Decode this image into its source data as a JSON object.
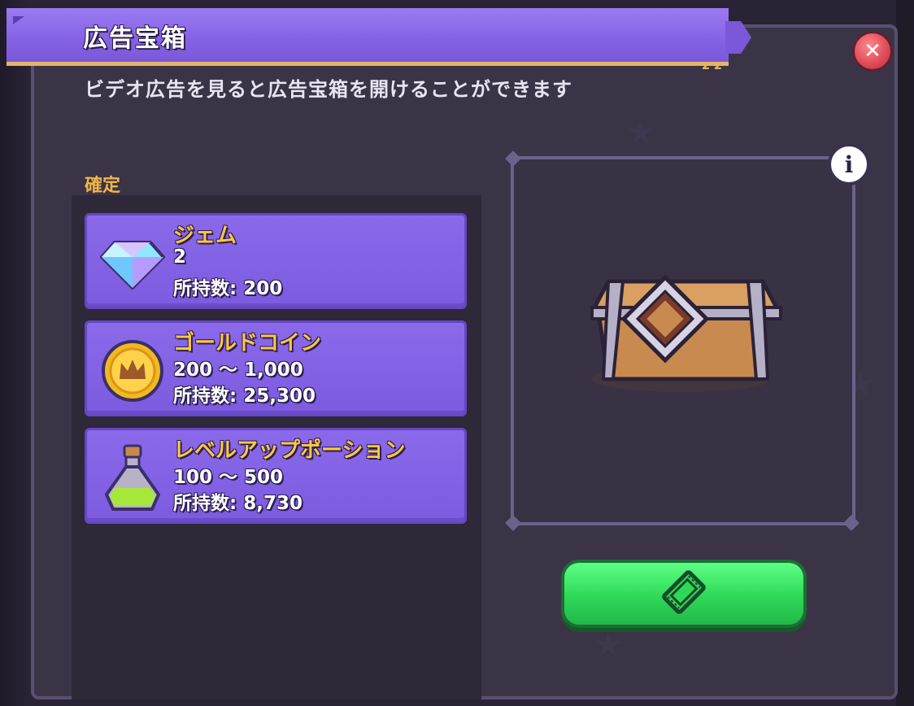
{
  "dialog": {
    "title": "広告宝箱",
    "subtitle": "ビデオ広告を見ると広告宝箱を開けることができます",
    "close_icon": "close-icon",
    "info_icon": "info-icon"
  },
  "rewards": {
    "section_label": "確定",
    "items": [
      {
        "name": "ジェム",
        "amount": "2",
        "owned": "所持数: 200",
        "icon": "gem-icon"
      },
      {
        "name": "ゴールドコイン",
        "amount": "200 ～ 1,000",
        "owned": "所持数: 25,300",
        "icon": "gold-coin-icon"
      },
      {
        "name": "レベルアップポーション",
        "amount": "100 ～ 500",
        "owned": "所持数: 8,730",
        "icon": "potion-icon"
      }
    ]
  },
  "preview": {
    "chest_icon": "treasure-chest-icon"
  },
  "watch_button": {
    "icon": "film-icon"
  },
  "colors": {
    "accent_purple": "#8462e4",
    "name_gold": "#ffc843",
    "button_green": "#2ed957",
    "close_red": "#e24c5a"
  }
}
